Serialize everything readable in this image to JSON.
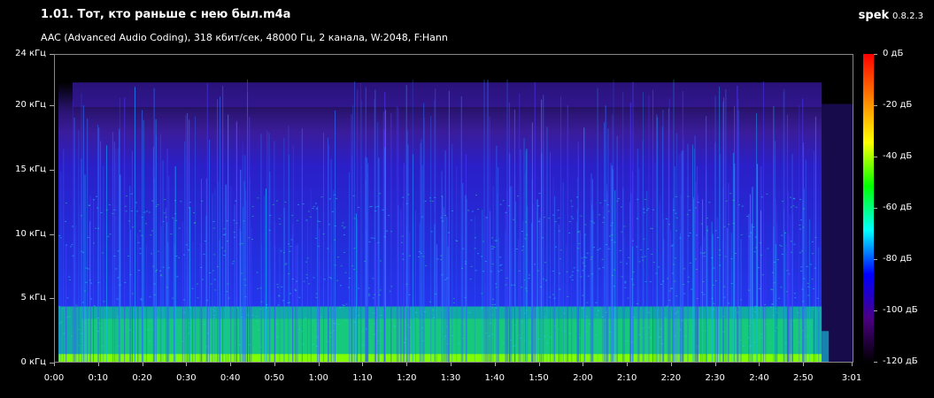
{
  "header": {
    "file_title": "1.01. Тот, кто раньше с нею был.m4a",
    "info": "AAC (Advanced Audio Coding), 318 кбит/сек, 48000 Гц, 2 канала, W:2048, F:Hann",
    "app_name": "spek",
    "app_version": "0.8.2.3"
  },
  "spectrogram": {
    "freq_labels": [
      "24 кГц",
      "20 кГц",
      "15 кГц",
      "10 кГц",
      "5 кГц",
      "0 кГц"
    ],
    "time_labels": [
      "0:00",
      "0:10",
      "0:20",
      "0:30",
      "0:40",
      "0:50",
      "1:00",
      "1:10",
      "1:20",
      "1:30",
      "1:40",
      "1:50",
      "2:00",
      "2:10",
      "2:20",
      "2:30",
      "2:40",
      "2:50",
      "3:01"
    ],
    "duration_seconds": 181,
    "max_freq_khz": 24
  },
  "scale": {
    "labels": [
      "0 дБ",
      "-20 дБ",
      "-40 дБ",
      "-60 дБ",
      "-80 дБ",
      "-100 дБ",
      "-120 дБ"
    ],
    "colors": [
      "#ff0000",
      "#ff8000",
      "#ffff00",
      "#00ff00",
      "#00ffff",
      "#0000ff",
      "#4b0082",
      "#000000"
    ]
  }
}
